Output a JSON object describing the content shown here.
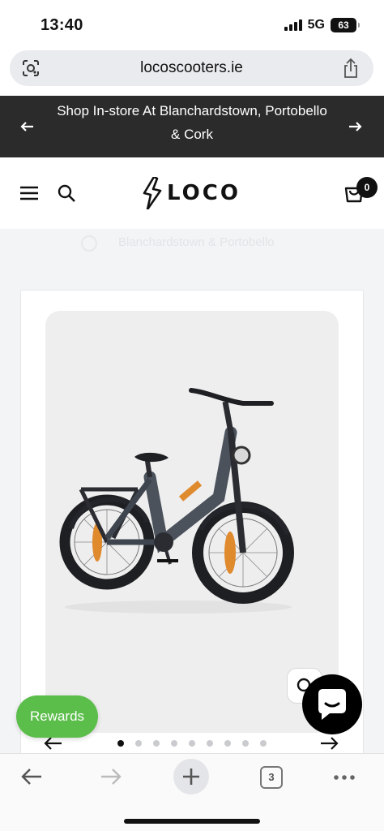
{
  "status_bar": {
    "time": "13:40",
    "network": "5G",
    "battery": "63",
    "signal_icon": "cellular-signal-icon"
  },
  "browser": {
    "url": "locoscooters.ie",
    "lens_icon": "lens-icon",
    "share_icon": "share-icon"
  },
  "announcement": {
    "text": "Shop In-store At Blanchardstown, Portobello & Cork",
    "prev_icon": "arrow-left-icon",
    "next_icon": "arrow-right-icon"
  },
  "header": {
    "logo_text": "LOCO",
    "cart_count": "0",
    "menu_icon": "hamburger-menu-icon",
    "search_icon": "search-icon",
    "cart_icon": "cart-icon"
  },
  "main": {
    "faded_location_text": "Blanchardstown & Portobello"
  },
  "gallery": {
    "image_alt": "Grey electric bike",
    "dot_count": 9,
    "active_dot": 0,
    "zoom_icon": "zoom-icon"
  },
  "widgets": {
    "rewards_label": "Rewards",
    "chat_icon": "chat-bubble-icon"
  },
  "toolbar": {
    "tab_count": "3",
    "back_icon": "back-arrow-icon",
    "forward_icon": "forward-arrow-icon",
    "new_tab_icon": "plus-icon",
    "more_icon": "more-dots-icon"
  },
  "colors": {
    "announcement_bg": "#2b2b2b",
    "rewards_green": "#5bbd4a",
    "page_grey": "#f3f4f5"
  }
}
